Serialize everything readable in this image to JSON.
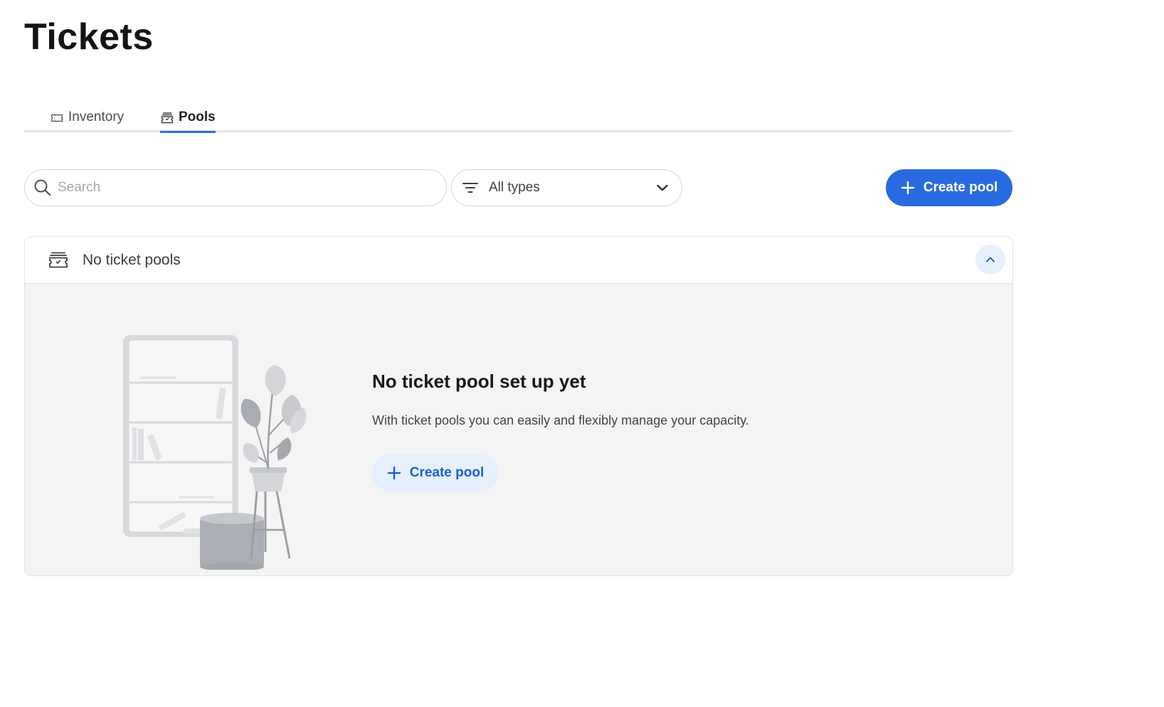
{
  "page": {
    "title": "Tickets"
  },
  "tabs": [
    {
      "label": "Inventory",
      "icon": "ticket-icon",
      "active": false
    },
    {
      "label": "Pools",
      "icon": "ticket-pool-icon",
      "active": true
    }
  ],
  "toolbar": {
    "search_placeholder": "Search",
    "search_value": "",
    "type_filter": {
      "icon": "filter-icon",
      "selected": "All types"
    },
    "create_button_label": "Create pool"
  },
  "panel": {
    "header_title": "No ticket pools",
    "header_icon": "ticket-pool-icon",
    "collapse_icon": "chevron-up-icon",
    "empty_state": {
      "title": "No ticket pool set up yet",
      "description": "With ticket pools you can easily and flexibly manage your capacity.",
      "button_label": "Create pool"
    }
  },
  "colors": {
    "accent": "#2a6ae0",
    "accent_light": "#e6effc",
    "panel_bg": "#f4f4f4",
    "border": "#e1e3e6"
  }
}
